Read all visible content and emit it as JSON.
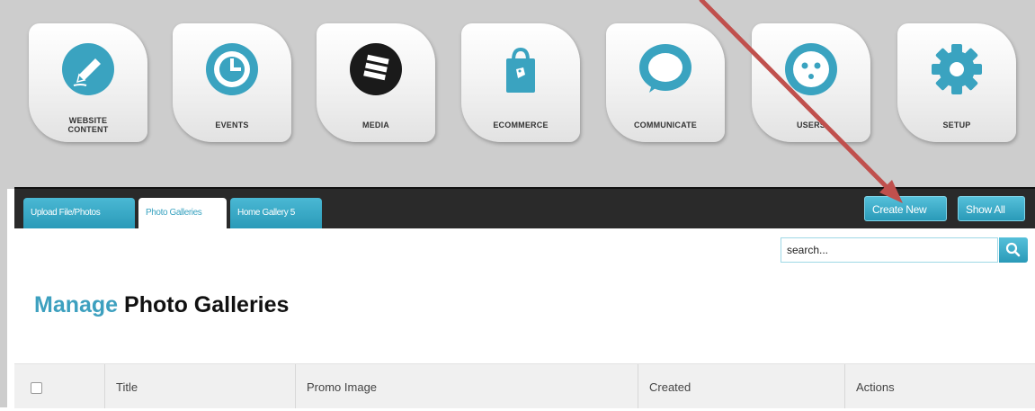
{
  "nav": {
    "tiles": [
      {
        "label": "WEBSITE\nCONTENT",
        "icon": "pencil-icon"
      },
      {
        "label": "EVENTS",
        "icon": "clock-icon"
      },
      {
        "label": "MEDIA",
        "icon": "media-stack-icon"
      },
      {
        "label": "ECOMMERCE",
        "icon": "shopping-bag-icon"
      },
      {
        "label": "COMMUNICATE",
        "icon": "speech-bubble-icon"
      },
      {
        "label": "USERS",
        "icon": "face-icon"
      },
      {
        "label": "SETUP",
        "icon": "gear-icon"
      }
    ]
  },
  "tabs": [
    {
      "label": "Upload File/Photos",
      "active": false
    },
    {
      "label": "Photo Galleries",
      "active": true
    },
    {
      "label": "Home Gallery 5",
      "active": false
    }
  ],
  "toolbar": {
    "create_new": "Create New",
    "show_all": "Show All"
  },
  "search": {
    "value": "search...",
    "icon": "search-icon"
  },
  "page_title": {
    "accent": "Manage",
    "main": "Photo Galleries"
  },
  "table": {
    "columns": [
      "Title",
      "Promo Image",
      "Created",
      "Actions"
    ]
  },
  "colors": {
    "accent": "#3da0bf",
    "tab_bar": "#2a2a2a",
    "arrow": "#c0504d"
  }
}
